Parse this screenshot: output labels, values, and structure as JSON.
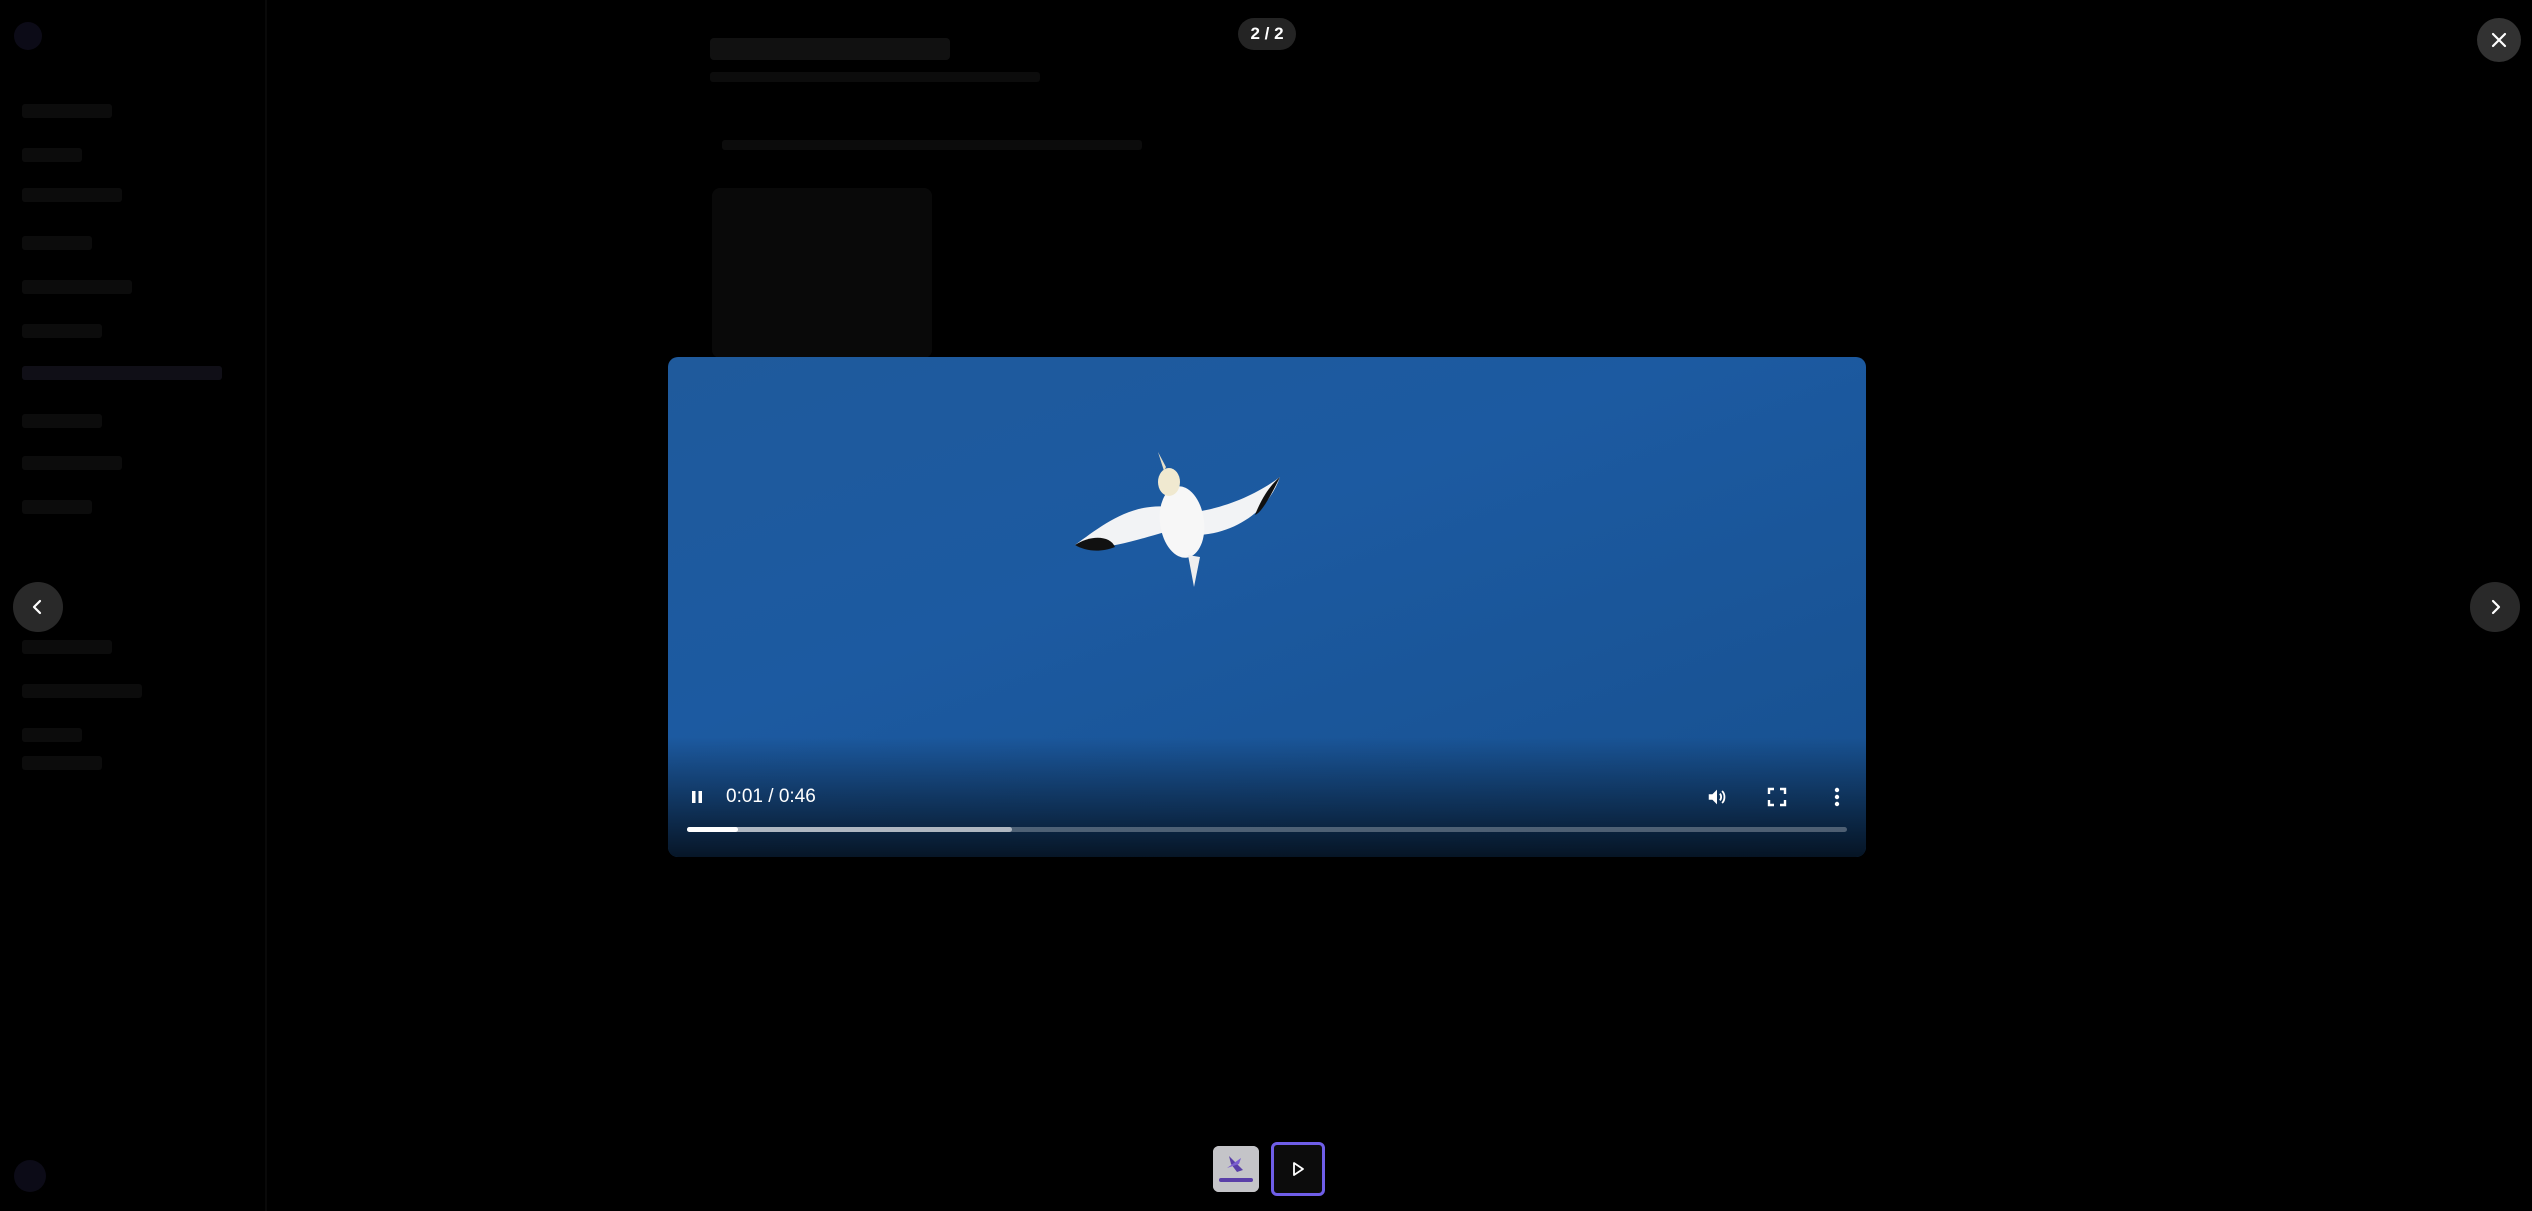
{
  "viewer": {
    "counter": "2 / 2",
    "current_index": 2,
    "total": 2
  },
  "video": {
    "time_display": "0:01 / 0:46",
    "played_fraction": 0.044,
    "buffered_fraction": 0.28,
    "state": "playing"
  },
  "icons": {
    "close": "close-icon",
    "prev": "chevron-left-icon",
    "next": "chevron-right-icon",
    "pause": "pause-icon",
    "volume": "volume-icon",
    "fullscreen": "fullscreen-icon",
    "more": "more-vertical-icon",
    "play": "play-icon"
  },
  "colors": {
    "accent": "#6f5ee8",
    "video_sky": "#1c5aa1"
  }
}
